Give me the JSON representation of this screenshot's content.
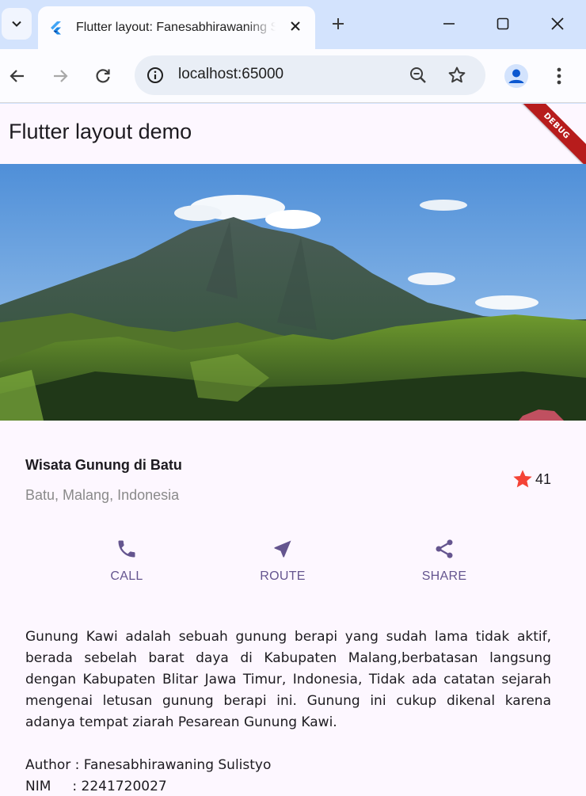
{
  "browser": {
    "tab": {
      "title": "Flutter layout: Fanesabhirawaning Sulistyo",
      "favicon": "flutter-icon"
    },
    "url": "localhost:65000",
    "icons": [
      "tab-search-icon",
      "close-icon",
      "plus-icon",
      "minimize-icon",
      "maximize-icon",
      "window-close-icon",
      "back-arrow-icon",
      "forward-arrow-icon",
      "reload-icon",
      "info-icon",
      "zoom-icon",
      "star-icon",
      "profile-icon",
      "more-vert-icon"
    ]
  },
  "app": {
    "title": "Flutter layout demo",
    "debug_label": "DEBUG",
    "place_name": "Wisata Gunung di Batu",
    "location": "Batu, Malang, Indonesia",
    "rating_count": "41",
    "actions": [
      {
        "label": "CALL",
        "icon": "phone-icon"
      },
      {
        "label": "ROUTE",
        "icon": "near-me-icon"
      },
      {
        "label": "SHARE",
        "icon": "share-icon"
      }
    ],
    "description": "Gunung Kawi adalah sebuah gunung berapi yang sudah lama tidak aktif, berada sebelah barat daya di Kabupaten Malang,berbatasan langsung dengan Kabupaten Blitar Jawa Timur, Indonesia, Tidak ada catatan sejarah mengenai letusan gunung berapi ini. Gunung ini cukup dikenal karena adanya tempat ziarah Pesarean Gunung Kawi.",
    "author_line": "Author : Fanesabhirawaning Sulistyo",
    "nim_line": "NIM     : 2241720027"
  },
  "colors": {
    "accent": "#65558f",
    "star": "#f44336",
    "page_bg": "#fdf7ff",
    "browser_frame": "#d3e3fd"
  }
}
